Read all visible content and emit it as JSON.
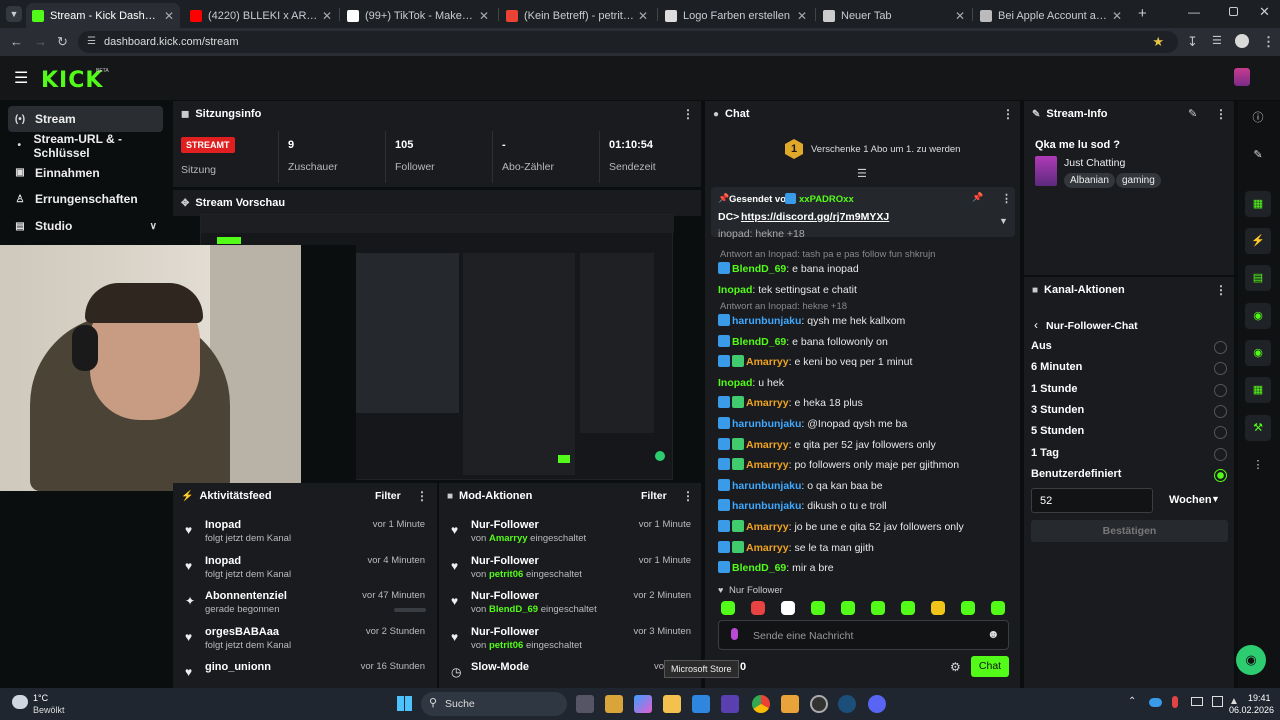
{
  "browser": {
    "tabs": [
      {
        "title": "Stream - Kick Dashboard",
        "active": true,
        "favicon": "kick-icon",
        "color": "#53fc18"
      },
      {
        "title": "(4220) BLLEKI x ARTUR - KOALI",
        "active": false,
        "favicon": "youtube-icon",
        "color": "#ff0000"
      },
      {
        "title": "(99+) TikTok - Make Your Day",
        "active": false,
        "favicon": "tiktok-icon",
        "color": "#ffffff"
      },
      {
        "title": "(Kein Betreff) - petritramadani3",
        "active": false,
        "favicon": "gmail-icon",
        "color": "#ea4335"
      },
      {
        "title": "Logo Farben erstellen",
        "active": false,
        "favicon": "chatgpt-icon",
        "color": "#dddddd"
      },
      {
        "title": "Neuer Tab",
        "active": false,
        "favicon": "chrome-icon",
        "color": "#cccccc"
      },
      {
        "title": "Bei Apple Account anmelden",
        "active": false,
        "favicon": "apple-icon",
        "color": "#bbbbbb"
      }
    ],
    "url": "dashboard.kick.com/stream"
  },
  "app": {
    "logo": "KICK",
    "beta": "BETA",
    "sidebar": [
      {
        "label": "Stream",
        "icon": "broadcast-icon",
        "active": true
      },
      {
        "label": "Stream-URL & -Schlüssel",
        "icon": "dot-icon"
      },
      {
        "label": "Einnahmen",
        "icon": "chart-icon"
      },
      {
        "label": "Errungenschaften",
        "icon": "trophy-icon"
      },
      {
        "label": "Studio",
        "icon": "studio-icon"
      }
    ],
    "session": {
      "title": "Sitzungsinfo",
      "status_badge": "STREAMT",
      "status_label": "Sitzung",
      "stats": [
        {
          "value": "9",
          "label": "Zuschauer"
        },
        {
          "value": "105",
          "label": "Follower"
        },
        {
          "value": "-",
          "label": "Abo-Zähler"
        },
        {
          "value": "01:10:54",
          "label": "Sendezeit"
        }
      ]
    },
    "preview": {
      "title": "Stream Vorschau"
    },
    "activity": {
      "title": "Aktivitätsfeed",
      "filter": "Filter",
      "items": [
        {
          "name": "Inopad",
          "sub": "folgt jetzt dem Kanal",
          "time": "vor 1 Minute"
        },
        {
          "name": "Inopad",
          "sub": "folgt jetzt dem Kanal",
          "time": "vor 4 Minuten"
        },
        {
          "name": "Abonnentenziel",
          "sub": "gerade begonnen",
          "time": "vor 47 Minuten"
        },
        {
          "name": "orgesBABAaa",
          "sub": "folgt jetzt dem Kanal",
          "time": "vor 2 Stunden"
        },
        {
          "name": "gino_unionn",
          "sub": "",
          "time": "vor 16 Stunden"
        }
      ]
    },
    "mod": {
      "title": "Mod-Aktionen",
      "filter": "Filter",
      "items": [
        {
          "name": "Nur-Follower",
          "by": "von",
          "user": "Amarryy",
          "action": "eingeschaltet",
          "time": "vor 1 Minute"
        },
        {
          "name": "Nur-Follower",
          "by": "von",
          "user": "petrit06",
          "action": "eingeschaltet",
          "time": "vor 1 Minute"
        },
        {
          "name": "Nur-Follower",
          "by": "von",
          "user": "BlendD_69",
          "action": "eingeschaltet",
          "time": "vor 2 Minuten"
        },
        {
          "name": "Nur-Follower",
          "by": "von",
          "user": "petrit06",
          "action": "eingeschaltet",
          "time": "vor 3 Minuten"
        },
        {
          "name": "Slow-Mode",
          "by": "",
          "user": "",
          "action": "",
          "time": "vor 37 M"
        }
      ]
    },
    "chat": {
      "title": "Chat",
      "gift_banner": "Verschenke 1 Abo um 1. zu werden",
      "gift_rank": "1",
      "pinned_by_label": "Gesendet von",
      "pinned_by": "xxPADROxx",
      "pinned_message_prefix": "DC>",
      "pinned_link": "https://discord.gg/rj7m9MYXJ",
      "cut_line": "inopad: hekne +18",
      "messages": [
        {
          "reply": "Antwort an Inopad: tash pa e pas follow fun shkrujn"
        },
        {
          "user": "BlendD_69",
          "color": "green",
          "badges": [
            "blue"
          ],
          "text": ": e bana inopad"
        },
        {
          "user": "Inopad",
          "color": "green",
          "badges": [],
          "text": ": tek settingsat e chatit"
        },
        {
          "reply": "Antwort an Inopad: hekne +18"
        },
        {
          "user": "harunbunjaku",
          "color": "blue",
          "badges": [
            "blue"
          ],
          "text": ": qysh me hek kallxom"
        },
        {
          "user": "BlendD_69",
          "color": "green",
          "badges": [
            "blue"
          ],
          "text": ": e bana followonly on"
        },
        {
          "user": "Amarryy",
          "color": "orange",
          "badges": [
            "blue",
            "green"
          ],
          "text": ": e keni bo veq per 1 minut"
        },
        {
          "user": "Inopad",
          "color": "green",
          "badges": [],
          "text": ": u hek"
        },
        {
          "user": "Amarryy",
          "color": "orange",
          "badges": [
            "blue",
            "green"
          ],
          "text": ": e heka 18 plus"
        },
        {
          "user": "harunbunjaku",
          "color": "blue",
          "badges": [
            "blue"
          ],
          "text": ": @Inopad qysh me ba"
        },
        {
          "user": "Amarryy",
          "color": "orange",
          "badges": [
            "blue",
            "green"
          ],
          "text": ": e qita per 52 jav followers only"
        },
        {
          "user": "Amarryy",
          "color": "orange",
          "badges": [
            "blue",
            "green"
          ],
          "text": ": po followers only maje per gjithmon"
        },
        {
          "user": "harunbunjaku",
          "color": "blue",
          "badges": [
            "blue"
          ],
          "text": ": o qa kan baa be"
        },
        {
          "user": "harunbunjaku",
          "color": "blue",
          "badges": [
            "blue"
          ],
          "text": ": dikush o tu e troll"
        },
        {
          "user": "Amarryy",
          "color": "orange",
          "badges": [
            "blue",
            "green"
          ],
          "text": ": jo be une e qita 52 jav followers only"
        },
        {
          "user": "Amarryy",
          "color": "orange",
          "badges": [
            "blue",
            "green"
          ],
          "text": ": se le ta man gjith"
        },
        {
          "user": "BlendD_69",
          "color": "green",
          "badges": [
            "blue"
          ],
          "text": ": mir a bre"
        }
      ],
      "mode_label": "Nur Follower",
      "input_placeholder": "Sende eine Nachricht",
      "viewer_count": "0",
      "send_label": "Chat",
      "tooltip": "Microsoft Store"
    },
    "stream_info": {
      "title": "Stream-Info",
      "stream_title": "Qka me lu sod ?",
      "category": "Just Chatting",
      "tags": [
        "Albanian",
        "gaming"
      ]
    },
    "channel_actions": {
      "title": "Kanal-Aktionen",
      "back_label": "Nur-Follower-Chat",
      "options": [
        "Aus",
        "6 Minuten",
        "1 Stunde",
        "3 Stunden",
        "5 Stunden",
        "1 Tag",
        "Benutzerdefiniert"
      ],
      "selected": "Benutzerdefiniert",
      "custom_value": "52",
      "unit": "Wochen",
      "confirm": "Bestätigen"
    }
  },
  "taskbar": {
    "weather_temp": "1°C",
    "weather_text": "Bewölkt",
    "search": "Suche",
    "time": "19:41",
    "date": "06.02.2026"
  }
}
